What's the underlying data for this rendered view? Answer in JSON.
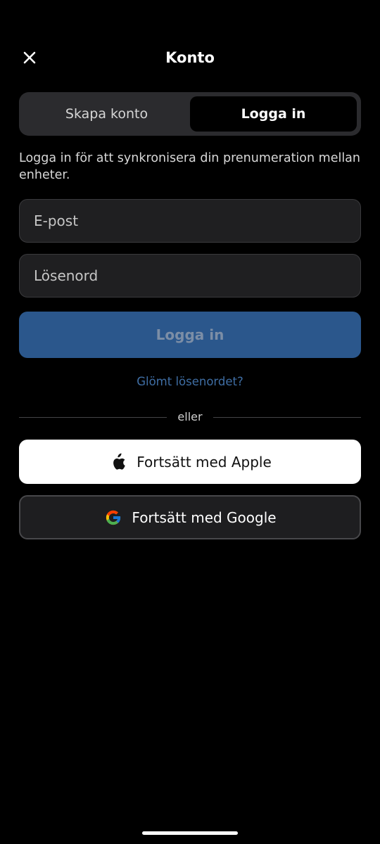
{
  "header": {
    "title": "Konto",
    "close_icon": "close-icon"
  },
  "segment": {
    "create_label": "Skapa konto",
    "login_label": "Logga in",
    "selected": "Logga in"
  },
  "description": "Logga in för att synkronisera din prenumeration mellan enheter.",
  "form": {
    "email_value": "",
    "email_placeholder": "E-post",
    "password_value": "",
    "password_placeholder": "Lösenord",
    "submit_label": "Logga in",
    "forgot_label": "Glömt lösenordet?"
  },
  "divider_text": "eller",
  "social": {
    "apple_label": "Fortsätt med Apple",
    "apple_icon": "apple-icon",
    "google_label": "Fortsätt med Google",
    "google_icon": "google-icon"
  },
  "colors": {
    "background": "#000000",
    "primary_button": "#2b578c",
    "link": "#3f6ea4",
    "field_background": "#1f1f21"
  }
}
